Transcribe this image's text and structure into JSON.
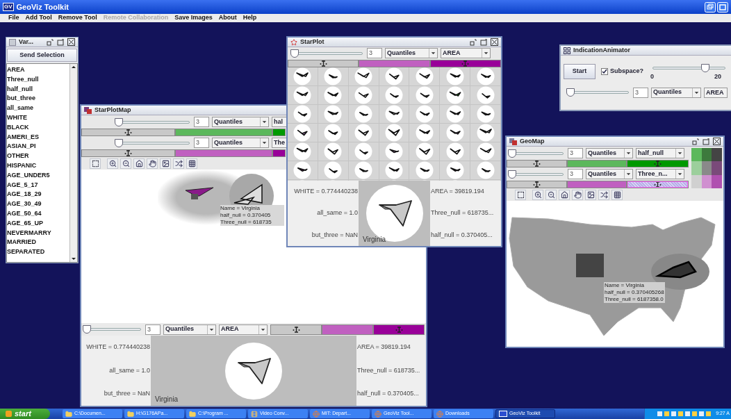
{
  "window": {
    "logo": "GV",
    "title": "GeoViz Toolkit"
  },
  "menu": [
    {
      "label": "File",
      "disabled": false
    },
    {
      "label": "Add Tool",
      "disabled": false
    },
    {
      "label": "Remove Tool",
      "disabled": false
    },
    {
      "label": "Remote Collaboration",
      "disabled": true
    },
    {
      "label": "Save Images",
      "disabled": false
    },
    {
      "label": "About",
      "disabled": false
    },
    {
      "label": "Help",
      "disabled": false
    }
  ],
  "variables_window": {
    "title": "Var...",
    "button": "Send Selection",
    "items": [
      "AREA",
      "Three_null",
      "half_null",
      "but_three",
      "all_same",
      "WHITE",
      "BLACK",
      "AMERI_ES",
      "ASIAN_PI",
      "OTHER",
      "HISPANIC",
      "AGE_UNDER5",
      "AGE_5_17",
      "AGE_18_29",
      "AGE_30_49",
      "AGE_50_64",
      "AGE_65_UP",
      "NEVERMARRY",
      "MARRIED",
      "SEPARATED"
    ]
  },
  "starplotmap_window": {
    "title": "StarPlotMap",
    "classifiers": [
      {
        "level": 0.0,
        "count": "3",
        "method": "Quantiles",
        "variable": "hal",
        "segments": [
          {
            "color": "#c8c8c8",
            "anchor": true
          },
          {
            "color": "#5cb85c",
            "anchor": false
          },
          {
            "color": "#009900",
            "anchor": false
          }
        ]
      },
      {
        "level": 0.0,
        "count": "3",
        "method": "Quantiles",
        "variable": "The",
        "segments": [
          {
            "color": "#c8c8c8",
            "anchor": true
          },
          {
            "color": "#c060c0",
            "anchor": false
          },
          {
            "color": "#990099",
            "anchor": false
          }
        ]
      }
    ],
    "tooltip": [
      "Name = Virginia",
      "half_null = 0.370405",
      "Three_null = 618735"
    ],
    "bottom_classifier": {
      "level": 0.0,
      "count": "3",
      "method": "Quantiles",
      "variable": "AREA",
      "segments": [
        {
          "color": "#c8c8c8",
          "anchor": true
        },
        {
          "color": "#c060c0",
          "anchor": false
        },
        {
          "color": "#990099",
          "anchor": true
        }
      ]
    },
    "detail": {
      "left": [
        "WHITE = 0.774440238",
        "all_same = 1.0",
        "but_three = NaN"
      ],
      "right": [
        "AREA = 39819.194",
        "Three_null = 618735...",
        "half_null = 0.370405..."
      ],
      "name": "Virginia"
    }
  },
  "starplot_window": {
    "title": "StarPlot",
    "classifier": {
      "level": 0.0,
      "count": "3",
      "method": "Quantiles",
      "variable": "AREA",
      "segments": [
        {
          "color": "#c8c8c8",
          "anchor": true
        },
        {
          "color": "#c060c0",
          "anchor": false
        },
        {
          "color": "#990099",
          "anchor": true
        }
      ]
    },
    "detail": {
      "left": [
        "WHITE = 0.774440238",
        "all_same = 1.0",
        "but_three = NaN"
      ],
      "right": [
        "AREA = 39819.194",
        "Three_null = 618735...",
        "half_null = 0.370405..."
      ],
      "name": "Virginia"
    }
  },
  "indication_window": {
    "title": "IndicationAnimator",
    "button": "Start",
    "checkbox": {
      "label": "Subspace?",
      "checked": true
    },
    "speed": {
      "level": 0.75,
      "min": "0",
      "max": "20"
    },
    "classifier": {
      "level": 0.0,
      "count": "3",
      "method": "Quantiles",
      "variable": "AREA"
    }
  },
  "geomap_window": {
    "title": "GeoMap",
    "classifiers": [
      {
        "level": 0.0,
        "count": "3",
        "method": "Quantiles",
        "variable": "half_null",
        "segments": [
          {
            "color": "#c8c8c8",
            "anchor": true,
            "selected": false
          },
          {
            "color": "#5cb85c",
            "anchor": false,
            "selected": false
          },
          {
            "color": "#009900",
            "anchor": true,
            "selected": false
          }
        ]
      },
      {
        "level": 0.0,
        "count": "3",
        "method": "Quantiles",
        "variable": "Three_n...",
        "segments": [
          {
            "color": "#c8c8c8",
            "anchor": true,
            "selected": false
          },
          {
            "color": "#c060c0",
            "anchor": false,
            "selected": false
          },
          {
            "color": "#b8b0e8",
            "anchor": true,
            "selected": true
          }
        ]
      }
    ],
    "legend": [
      {
        "color": "#5cb85c"
      },
      {
        "color": "#3d7a3d"
      },
      {
        "color": "#444444"
      },
      {
        "color": "#9ccf9c"
      },
      {
        "color": "#8a8a8a"
      },
      {
        "color": "#7a4a7a"
      },
      {
        "color": "#d0d0d0"
      },
      {
        "color": "#d090d0"
      },
      {
        "color": "#b050b0"
      }
    ],
    "tooltip": [
      "Name = Virginia",
      "half_null = 0.370405268",
      "Three_null = 6187358.0"
    ]
  },
  "taskbar": {
    "start": "start",
    "items": [
      {
        "label": "C:\\Documen...",
        "kind": "folder",
        "selected": false
      },
      {
        "label": "H:\\G176APa...",
        "kind": "folder",
        "selected": false
      },
      {
        "label": "C:\\Program ...",
        "kind": "folder",
        "selected": false
      },
      {
        "label": "Video Conv...",
        "kind": "video",
        "selected": false
      },
      {
        "label": "MIT: Depart...",
        "kind": "browser",
        "selected": false
      },
      {
        "label": "GeoViz Tool...",
        "kind": "browser",
        "selected": false
      },
      {
        "label": "Downloads",
        "kind": "browser",
        "selected": false
      },
      {
        "label": "GeoViz Toolkit",
        "kind": "app",
        "selected": true
      }
    ],
    "clock": "9:27 A"
  }
}
